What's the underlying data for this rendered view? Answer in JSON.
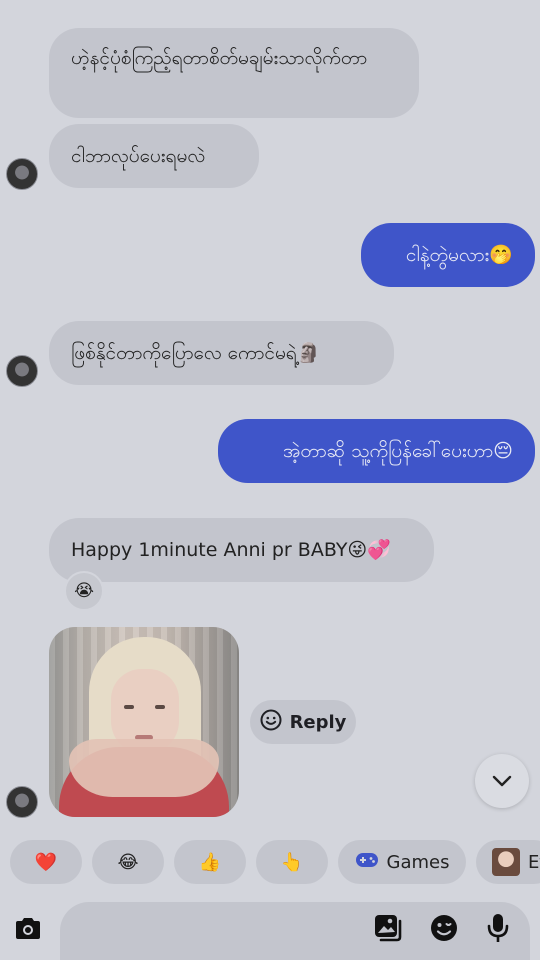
{
  "messages": [
    {
      "id": "m1",
      "text": "ဟဲ့နင့်ပုံစံကြည့်ရတာစိတ်မချမ်းသာလိုက်တာ"
    },
    {
      "id": "m2",
      "text": "ငါဘာလုပ်ပေးရမလဲ"
    },
    {
      "id": "m3",
      "text": "ငါနဲ့တွဲမလား🤭"
    },
    {
      "id": "m4",
      "text": "ဖြစ်နိုင်တာကိုပြောလေ ကောင်မရဲ့🗿"
    },
    {
      "id": "m5",
      "text": "အဲ့တာဆို သူ့ကိုပြန်ခေါ်ပေးဟာ😔"
    },
    {
      "id": "m6",
      "text": "Happy 1minute Anni pr BABY😜💞"
    }
  ],
  "reaction": "😭",
  "reply_button": {
    "label": "Reply",
    "icon": "smile-icon"
  },
  "quick_chips": [
    {
      "emoji": "❤️"
    },
    {
      "emoji": "😂"
    },
    {
      "emoji": "👍"
    },
    {
      "emoji": "👆"
    },
    {
      "icon": "gamepad-icon",
      "label": "Games",
      "icon_color": "#3f55c9"
    },
    {
      "icon": "effects-icon",
      "label": "Ef"
    }
  ],
  "colors": {
    "background": "#d3d5dc",
    "incoming": "#c3c5cd",
    "outgoing": "#3f55c9"
  },
  "composer": {
    "icons": [
      "camera-icon",
      "gallery-icon",
      "sticker-icon",
      "microphone-icon"
    ]
  }
}
